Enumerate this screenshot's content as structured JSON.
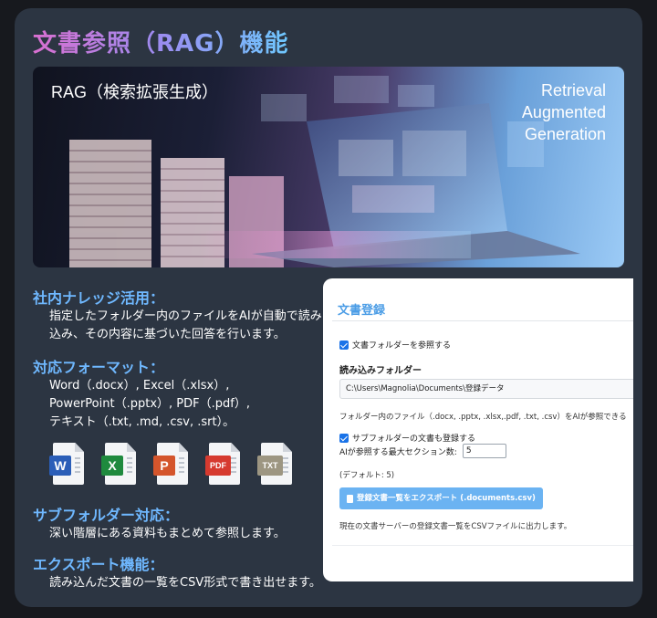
{
  "title": "文書参照（RAG）機能",
  "hero": {
    "label": "RAG（検索拡張生成）",
    "right_lines": [
      "Retrieval",
      "Augmented",
      "Generation"
    ]
  },
  "sections": [
    {
      "heading": "社内ナレッジ活用：",
      "lines": [
        "指定したフォルダー内のファイルをAIが自動で読み",
        "込み、その内容に基づいた回答を行います。"
      ]
    },
    {
      "heading": "対応フォーマット：",
      "lines": [
        "Word（.docx）, Excel（.xlsx）,",
        "PowerPoint（.pptx）, PDF（.pdf）,",
        "テキスト（.txt, .md, .csv, .srt）。"
      ]
    },
    {
      "heading": "サブフォルダー対応：",
      "lines": [
        "深い階層にある資料もまとめて参照します。"
      ]
    },
    {
      "heading": "エクスポート機能：",
      "lines": [
        "読み込んだ文書の一覧をCSV形式で書き出せます。"
      ]
    }
  ],
  "file_icons": [
    {
      "name": "word-icon",
      "letter": "W",
      "color": "#2b5eb8"
    },
    {
      "name": "excel-icon",
      "letter": "X",
      "color": "#1f8a3e"
    },
    {
      "name": "powerpoint-icon",
      "letter": "P",
      "color": "#d4552c"
    },
    {
      "name": "pdf-icon",
      "letter": "PDF",
      "color": "#d63a2f"
    },
    {
      "name": "txt-icon",
      "letter": "TXT",
      "color": "#9d9682"
    }
  ],
  "panel": {
    "title": "文書登録",
    "ref_folder_checkbox": "文書フォルダーを参照する",
    "folder_label": "読み込みフォルダー",
    "folder_path": "C:\\Users\\Magnolia\\Documents\\登録データ",
    "description": "フォルダー内のファイル（.docx, .pptx, .xlsx,.pdf, .txt, .csv）をAIが参照できる",
    "subfolder_checkbox": "サブフォルダーの文書も登録する",
    "max_sections_label": "AIが参照する最大セクション数:",
    "max_sections_value": "5",
    "default_note": "(デフォルト: 5)",
    "export_button": "登録文書一覧をエクスポート (.documents.csv)",
    "export_note": "現在の文書サーバーの登録文書一覧をCSVファイルに出力します。"
  },
  "colors": {
    "accent": "#6fb8ff",
    "card_bg": "#2c3542",
    "button": "#6bb3f2"
  }
}
